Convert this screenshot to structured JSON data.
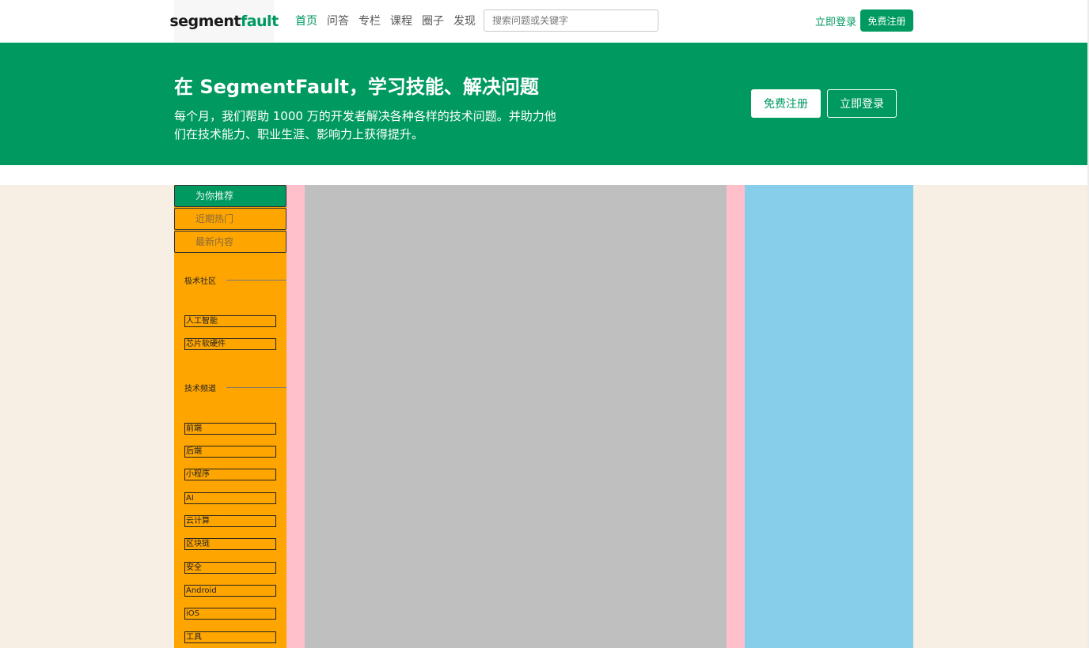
{
  "header": {
    "logo_part1": "segment",
    "logo_part2": "fault",
    "nav": [
      "首页",
      "问答",
      "专栏",
      "课程",
      "圈子",
      "发现"
    ],
    "search_placeholder": "搜索问题或关键字",
    "login": "立即登录",
    "register": "免费注册"
  },
  "hero": {
    "title": "在 SegmentFault，学习技能、解决问题",
    "subtitle": "每个月，我们帮助 1000 万的开发者解决各种各样的技术问题。并助力他们在技术能力、职业生涯、影响力上获得提升。",
    "register": "免费注册",
    "login": "立即登录"
  },
  "sidebar": {
    "tabs": [
      "为你推荐",
      "近期热门",
      "最新内容"
    ],
    "section1": {
      "label": "极术社区",
      "items": [
        "人工智能",
        "芯片软硬件"
      ]
    },
    "section2": {
      "label": "技术频道",
      "items": [
        "前端",
        "后端",
        "小程序",
        "AI",
        "云计算",
        "区块链",
        "安全",
        "Android",
        "iOS",
        "工具"
      ]
    }
  },
  "colors": {
    "brand": "#009a61",
    "sidebar_bg": "#ffa500",
    "main_bg": "#bfbfbf",
    "gutter": "#ffc0cb",
    "right_col": "#87ceeb",
    "page_bg": "#f8efe4"
  }
}
